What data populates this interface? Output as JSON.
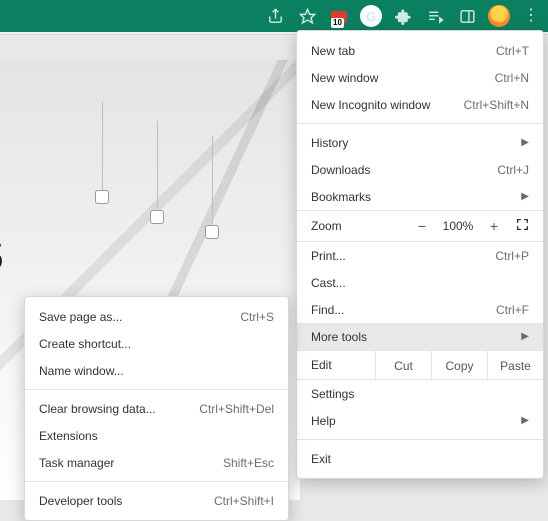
{
  "toolbar": {
    "ext_badge": "10",
    "grammarly_letter": "G"
  },
  "background": {
    "partial_text": "s"
  },
  "menu": {
    "new_tab": "New tab",
    "new_tab_k": "Ctrl+T",
    "new_window": "New window",
    "new_window_k": "Ctrl+N",
    "incognito": "New Incognito window",
    "incognito_k": "Ctrl+Shift+N",
    "history": "History",
    "downloads": "Downloads",
    "downloads_k": "Ctrl+J",
    "bookmarks": "Bookmarks",
    "zoom_label": "Zoom",
    "zoom_value": "100%",
    "print": "Print...",
    "print_k": "Ctrl+P",
    "cast": "Cast...",
    "find": "Find...",
    "find_k": "Ctrl+F",
    "more_tools": "More tools",
    "edit_label": "Edit",
    "cut": "Cut",
    "copy": "Copy",
    "paste": "Paste",
    "settings": "Settings",
    "help": "Help",
    "exit": "Exit"
  },
  "submenu": {
    "save_page": "Save page as...",
    "save_page_k": "Ctrl+S",
    "create_shortcut": "Create shortcut...",
    "name_window": "Name window...",
    "clear_data": "Clear browsing data...",
    "clear_data_k": "Ctrl+Shift+Del",
    "extensions": "Extensions",
    "task_manager": "Task manager",
    "task_manager_k": "Shift+Esc",
    "dev_tools": "Developer tools",
    "dev_tools_k": "Ctrl+Shift+I"
  }
}
